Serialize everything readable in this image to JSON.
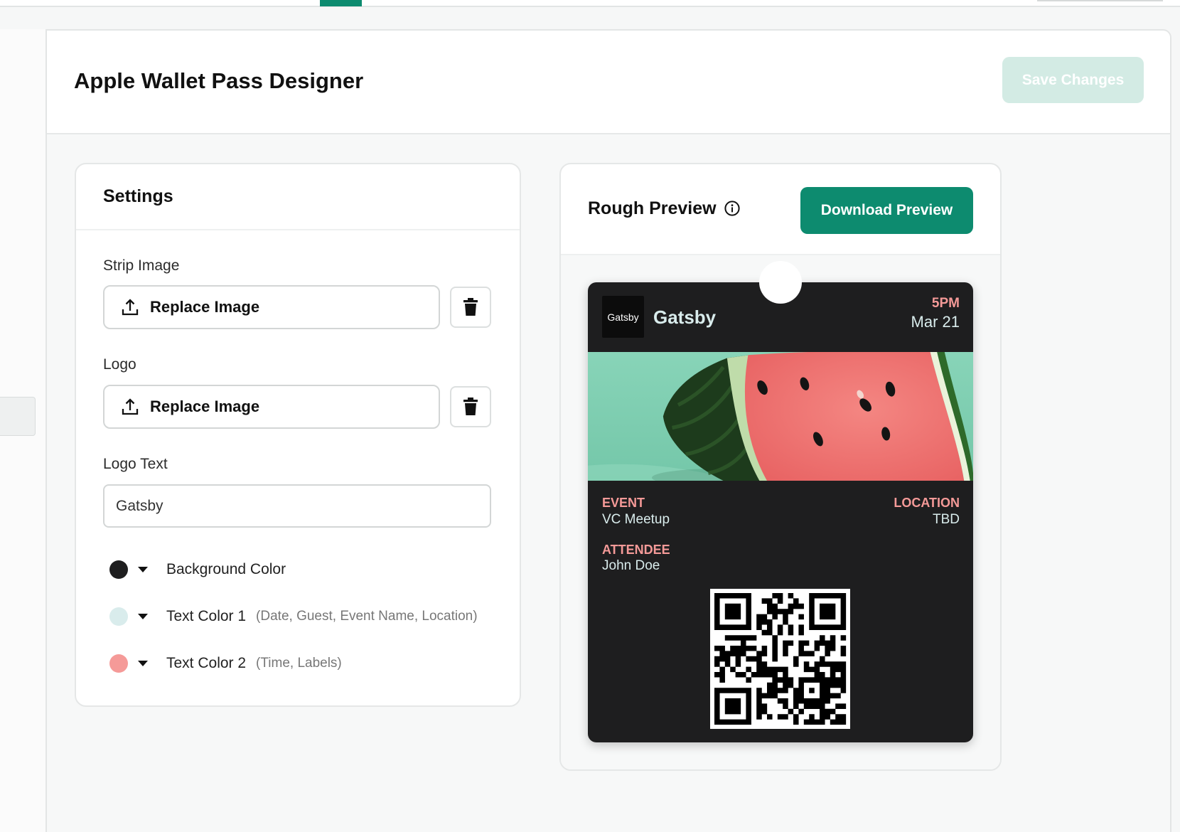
{
  "header": {
    "title": "Apple Wallet Pass Designer",
    "save_label": "Save Changes"
  },
  "settings": {
    "title": "Settings",
    "strip_image": {
      "label": "Strip Image",
      "button_label": "Replace Image"
    },
    "logo": {
      "label": "Logo",
      "button_label": "Replace Image"
    },
    "logo_text": {
      "label": "Logo Text",
      "value": "Gatsby"
    },
    "colors": [
      {
        "label": "Background Color",
        "color": "#1e1e1f"
      },
      {
        "label": "Text Color 1",
        "hint": "(Date, Guest, Event Name, Location)",
        "color": "#d9ecec"
      },
      {
        "label": "Text Color 2",
        "hint": "(Time, Labels)",
        "color": "#f59a98"
      }
    ]
  },
  "preview": {
    "title": "Rough Preview",
    "download_label": "Download Preview",
    "pass": {
      "logo_image_text": "Gatsby",
      "logo_text": "Gatsby",
      "time": "5PM",
      "date": "Mar 21",
      "event": {
        "label": "EVENT",
        "value": "VC Meetup"
      },
      "location": {
        "label": "LOCATION",
        "value": "TBD"
      },
      "attendee": {
        "label": "ATTENDEE",
        "value": "John Doe"
      }
    }
  },
  "theme": {
    "accent": "#0d8b6f",
    "accent_disabled": "#d3ebe4"
  },
  "icons": [
    "upload-icon",
    "trash-icon",
    "info-icon",
    "caret-down-icon"
  ]
}
